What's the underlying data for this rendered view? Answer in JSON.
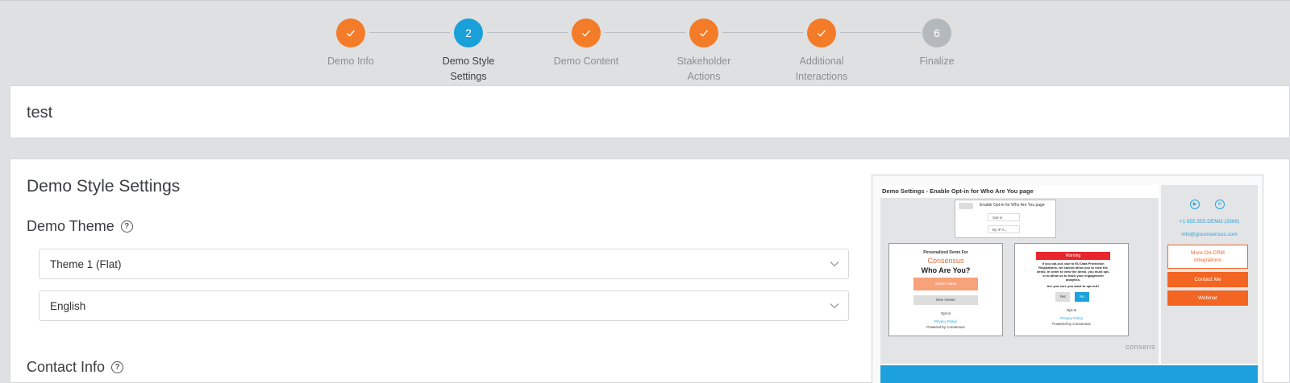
{
  "stepper": {
    "steps": [
      {
        "number": "",
        "label_line1": "Demo Info",
        "label_line2": "",
        "status": "done"
      },
      {
        "number": "2",
        "label_line1": "Demo Style",
        "label_line2": "Settings",
        "status": "active"
      },
      {
        "number": "",
        "label_line1": "Demo Content",
        "label_line2": "",
        "status": "done"
      },
      {
        "number": "",
        "label_line1": "Stakeholder",
        "label_line2": "Actions",
        "status": "done"
      },
      {
        "number": "",
        "label_line1": "Additional",
        "label_line2": "Interactions",
        "status": "done"
      },
      {
        "number": "6",
        "label_line1": "Finalize",
        "label_line2": "",
        "status": "todo"
      }
    ]
  },
  "demo_name": "test",
  "style_settings": {
    "heading": "Demo Style Settings",
    "theme_heading": "Demo Theme",
    "theme_select": "Theme 1 (Flat)",
    "language_select": "English",
    "contact_heading": "Contact Info",
    "help_glyph": "?"
  },
  "preview": {
    "title": "Demo Settings - Enable Opt-in for Who Are You page",
    "enable_optin": "Enable Opt-in for Who Are You page",
    "sel_optin": "Opt-in",
    "sel_byip": "By IP A...",
    "left_panel": {
      "line1": "Personalized Demo For",
      "brand": "Consensus",
      "question": "Who Are You?",
      "name_btn": "Viewer Name",
      "new_viewer": "New Viewer",
      "optin": "Opt-in",
      "privacy": "Privacy Policy",
      "powered": "Powered by Consensus"
    },
    "right_panel": {
      "warning": "Warning",
      "body": "If you opt-out, due to EU Data Protection Regulations, we cannot allow you to view the demo. In order to view the demo, you must opt-in to allow us to track your engagement analytics.",
      "confirm": "Are you sure you want to opt-out?",
      "yes": "Yes",
      "no": "No",
      "optin": "Opt-In",
      "privacy": "Privacy Policy",
      "powered": "Powered by Consensus"
    },
    "watermark": "consens",
    "contact": {
      "phone": "+1 855.555.DEMO (3366)",
      "email": "info@goconsensus.com",
      "more_btn_line1": "More On CRM",
      "more_btn_line2": "Integrations",
      "contact_btn": "Contact Me",
      "webinar_btn": "Webinar"
    }
  },
  "colors": {
    "done": "#f47b27",
    "active": "#1aa0d9",
    "todo": "#b4b9be",
    "accent_orange": "#f26522",
    "preview_blue": "#1ca1dc"
  }
}
